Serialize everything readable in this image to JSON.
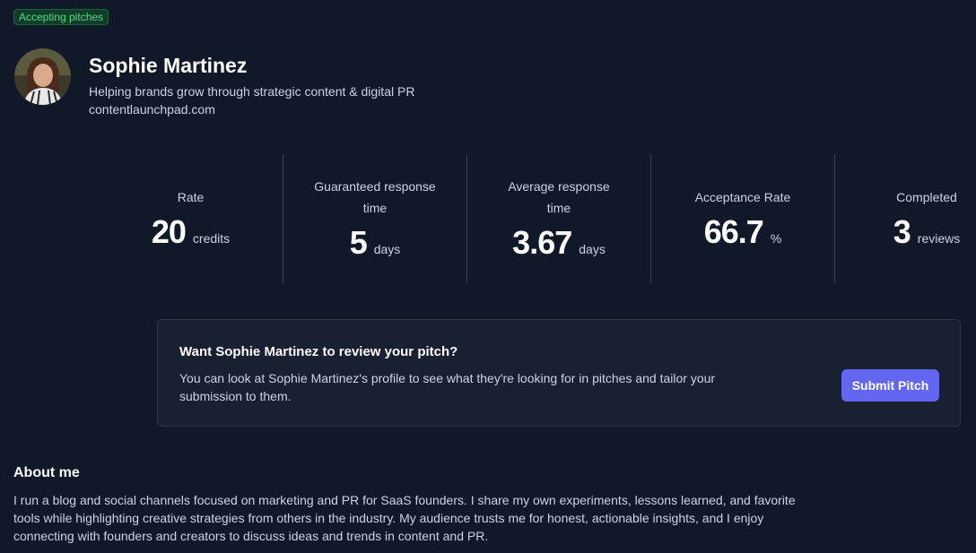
{
  "status_badge": "Accepting pitches",
  "profile": {
    "name": "Sophie Martinez",
    "tagline": "Helping brands grow through strategic content & digital PR",
    "website": "contentlaunchpad.com"
  },
  "stats": [
    {
      "label": "Rate",
      "value": "20",
      "unit": "credits"
    },
    {
      "label": "Guaranteed response time",
      "value": "5",
      "unit": "days"
    },
    {
      "label": "Average response time",
      "value": "3.67",
      "unit": "days"
    },
    {
      "label": "Acceptance Rate",
      "value": "66.7",
      "unit": "%"
    },
    {
      "label": "Completed",
      "value": "3",
      "unit": "reviews"
    }
  ],
  "pitch_card": {
    "title": "Want Sophie Martinez to review your pitch?",
    "description": "You can look at Sophie Martinez's profile to see what they're looking for in pitches and tailor your submission to them.",
    "button_label": "Submit Pitch"
  },
  "about": {
    "title": "About me",
    "text": "I run a blog and social channels focused on marketing and PR for SaaS founders. I share my own experiments, lessons learned, and favorite tools while highlighting creative strategies from others in the industry. My audience trusts me for honest, actionable insights, and I enjoy connecting with founders and creators to discuss ideas and trends in content and PR."
  },
  "colors": {
    "background": "#111827",
    "accent": "#6366f1",
    "badge_green": "#4ade80"
  }
}
